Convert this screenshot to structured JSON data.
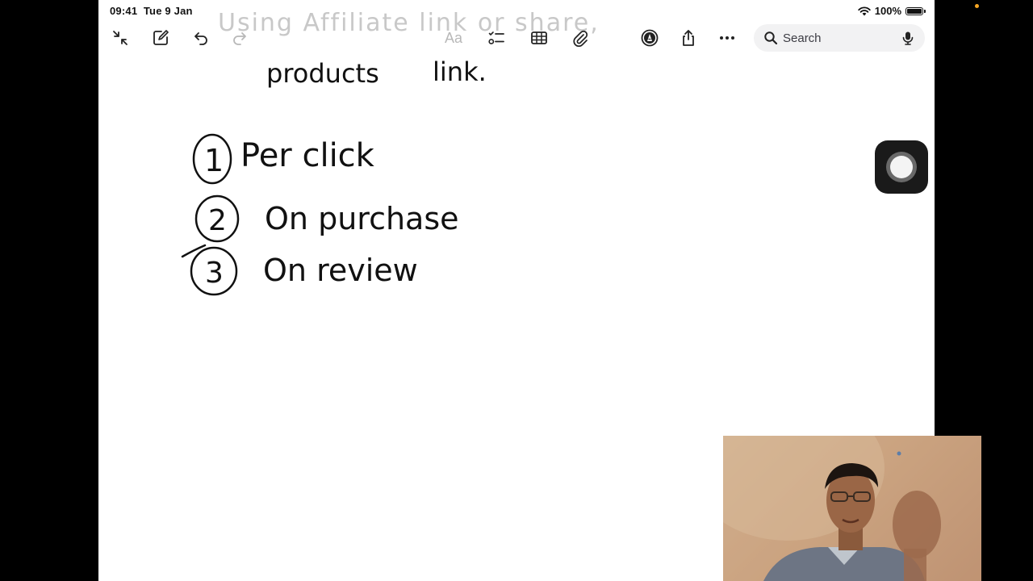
{
  "status": {
    "time": "09:41",
    "date": "Tue 9 Jan",
    "battery": "100%"
  },
  "toolbar": {
    "icons": [
      "collapse-icon",
      "compose-icon",
      "undo-icon",
      "redo-icon",
      "text-format-icon",
      "checklist-icon",
      "table-icon",
      "attachment-icon",
      "markup-icon",
      "share-icon",
      "more-icon"
    ],
    "format_label": "Aa"
  },
  "search": {
    "placeholder": "Search"
  },
  "note": {
    "faded_line": "Using Affiliate link or share,",
    "line2_word1": "products",
    "line2_word2": "link.",
    "items": [
      {
        "number": "1",
        "text": "Per  click"
      },
      {
        "number": "2",
        "text": "On  purchase"
      },
      {
        "number": "3",
        "text": "On  review"
      }
    ]
  },
  "colors": {
    "ink": "#111111",
    "page": "#ffffff",
    "background": "#000000",
    "indicator": "#f5a623"
  }
}
